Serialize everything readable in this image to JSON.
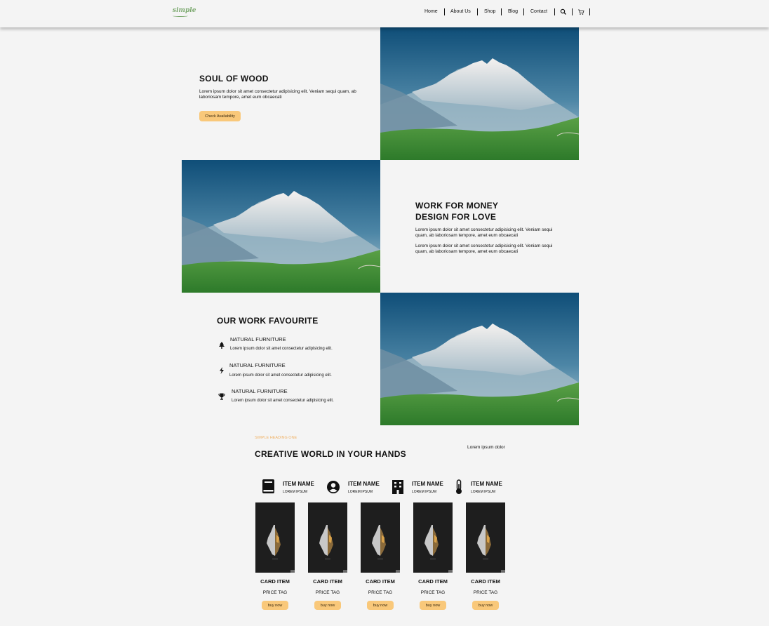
{
  "header": {
    "logo": "simple",
    "nav": [
      "Home",
      "About Us",
      "Shop",
      "Blog",
      "Contact"
    ],
    "search_icon": "search-icon",
    "cart_icon": "cart-icon"
  },
  "section1": {
    "title": "SOUL OF WOOD",
    "text": "Lorem ipsum dolor sit amet consectetur adipisicing elit. Veniam sequi quam, ab laboriosam tempore, amet eum obcaecati",
    "button": "Check Availability"
  },
  "section2": {
    "title_line1": "WORK FOR MONEY",
    "title_line2": "DESIGN FOR LOVE",
    "text1": "Lorem ipsum dolor sit amet consectetur adipisicing elit. Veniam sequi quam, ab laboriosam tempore, amet eum obcaecati",
    "text2": "Lorem ipsum dolor sit amet consectetur adipisicing elit. Veniam sequi quam, ab laboriosam tempore, amet eum obcaecati"
  },
  "section3": {
    "title": "OUR WORK FAVOURITE",
    "features": [
      {
        "icon": "tree-icon",
        "title": "NATURAL FURNITURE",
        "text": "Lorem ipsum dolor sit amet consectetur adipisicing elit."
      },
      {
        "icon": "bolt-icon",
        "title": "NATURAL FURNITURE",
        "text": "Lorem ipsum dolor sit amet consectetur adipisicing elit."
      },
      {
        "icon": "trophy-icon",
        "title": "NATURAL FURNITURE",
        "text": "Lorem ipsum dolor sit amet consectetur adipisicing elit."
      }
    ]
  },
  "section4": {
    "kicker": "SIMPLE HEADING ONE",
    "title": "CREATIVE WORLD IN YOUR HANDS",
    "aside": "Lorem ipsum dolor",
    "categories": [
      {
        "icon": "book-icon",
        "name": "ITEM NAME",
        "sub": "LOREM IPSUM"
      },
      {
        "icon": "user-circle-icon",
        "name": "ITEM NAME",
        "sub": "LOREM IPSUM"
      },
      {
        "icon": "building-icon",
        "name": "ITEM NAME",
        "sub": "LOREM IPSUM"
      },
      {
        "icon": "thermometer-icon",
        "name": "ITEM NAME",
        "sub": "LOREM IPSUM"
      }
    ],
    "cards": [
      {
        "title": "CARD ITEM",
        "price": "PRICE TAG",
        "button": "buy now"
      },
      {
        "title": "CARD ITEM",
        "price": "PRICE TAG",
        "button": "buy now"
      },
      {
        "title": "CARD ITEM",
        "price": "PRICE TAG",
        "button": "buy now"
      },
      {
        "title": "CARD ITEM",
        "price": "PRICE TAG",
        "button": "buy now"
      },
      {
        "title": "CARD ITEM",
        "price": "PRICE TAG",
        "button": "buy now"
      }
    ]
  },
  "colors": {
    "accent": "#f9c87a",
    "kicker": "#f0b46a",
    "logo": "#7aa86d",
    "background": "#f4f4f4"
  }
}
